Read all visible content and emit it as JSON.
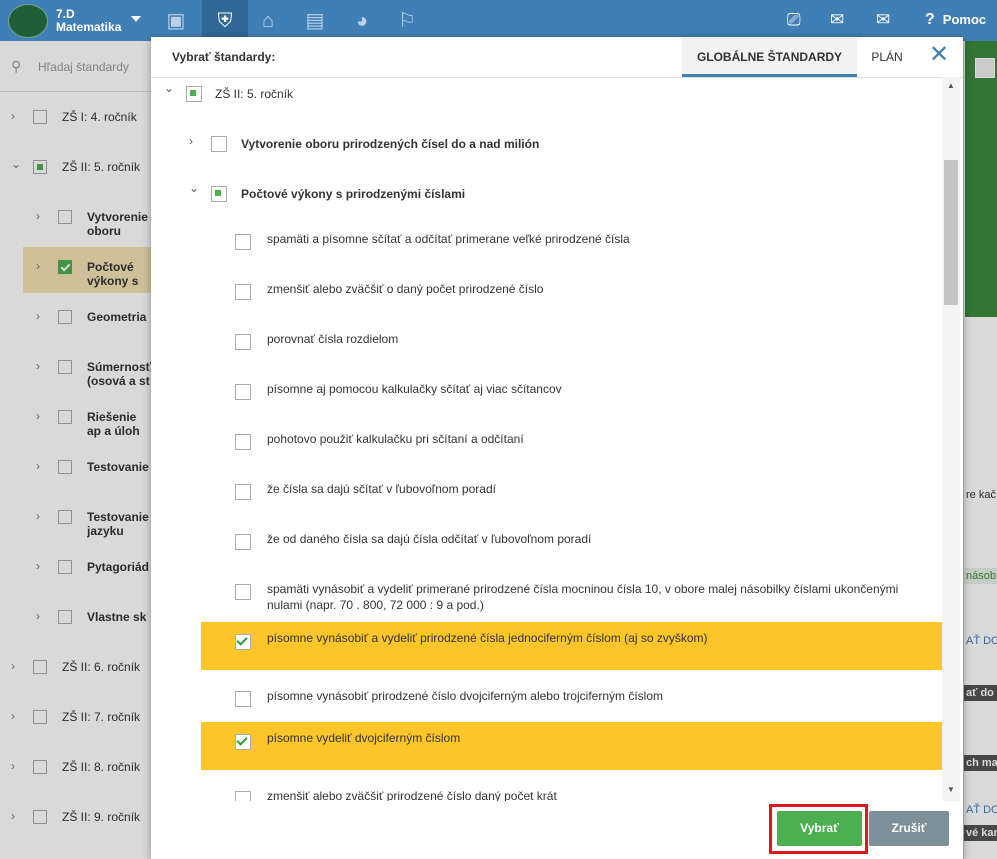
{
  "topbar": {
    "class_name": "7.D",
    "subject": "Matematika",
    "help_label": "Pomoc",
    "nav_icons": [
      "briefcase-icon",
      "shield-check-icon",
      "school-icon",
      "bar-chart-icon",
      "chart-circle-icon",
      "people-walking-icon"
    ],
    "right_icons": [
      "cast-icon",
      "chat-icon",
      "mail-icon"
    ]
  },
  "sidebar": {
    "search_placeholder": "Hľadaj štandardy",
    "items": [
      {
        "label": "ZŠ I: 4. ročník",
        "state": "empty",
        "level": 0,
        "expanded": false
      },
      {
        "label": "ZŠ II: 5. ročník",
        "state": "partial",
        "level": 0,
        "expanded": true
      },
      {
        "label": "Vytvorenie oboru prirodzených",
        "state": "empty",
        "level": 1,
        "expanded": false
      },
      {
        "label": "Počtové výkony s prirodzenými",
        "state": "green",
        "level": 1,
        "expanded": false
      },
      {
        "label": "Geometria",
        "state": "empty",
        "level": 1,
        "expanded": false
      },
      {
        "label": "Súmernosť (osová a st",
        "state": "empty",
        "level": 1,
        "expanded": false
      },
      {
        "label": "Riešenie ap a úloh rozv",
        "state": "empty",
        "level": 1,
        "expanded": false
      },
      {
        "label": "Testovanie",
        "state": "empty",
        "level": 1,
        "expanded": false
      },
      {
        "label": "Testovanie jazyku",
        "state": "empty",
        "level": 1,
        "expanded": false
      },
      {
        "label": "Pytagoriád",
        "state": "empty",
        "level": 1,
        "expanded": false
      },
      {
        "label": "Vlastne sk",
        "state": "empty",
        "level": 1,
        "expanded": false
      },
      {
        "label": "ZŠ II: 6. ročník",
        "state": "empty",
        "level": 0,
        "expanded": false
      },
      {
        "label": "ZŠ II: 7. ročník",
        "state": "empty",
        "level": 0,
        "expanded": false
      },
      {
        "label": "ZŠ II: 8. ročník",
        "state": "empty",
        "level": 0,
        "expanded": false
      },
      {
        "label": "ZŠ II: 9. ročník",
        "state": "empty",
        "level": 0,
        "expanded": false
      }
    ]
  },
  "right_fragments": [
    "re kač",
    "násob",
    "AŤ DO",
    "ať do m",
    "ch mat",
    "AŤ DO",
    "vé kart"
  ],
  "modal": {
    "title": "Vybrať štandardy:",
    "tabs": [
      {
        "label": "GLOBÁLNE ŠTANDARDY",
        "active": true
      },
      {
        "label": "PLÁN",
        "active": false
      }
    ],
    "grade": {
      "label": "ZŠ II: 5. ročník",
      "state": "partial"
    },
    "categories": [
      {
        "label": "Vytvorenie oboru prirodzených čísel do a nad milión",
        "state": "empty",
        "expanded": false
      },
      {
        "label": "Počtové výkony s prirodzenými číslami",
        "state": "partial",
        "expanded": true
      }
    ],
    "standards": [
      {
        "label": "spamäti a písomne sčítať a odčítať primerane veľké prirodzené čísla",
        "checked": false
      },
      {
        "label": "zmenšiť alebo zväčšiť o daný počet prirodzené číslo",
        "checked": false
      },
      {
        "label": "porovnať čísla rozdielom",
        "checked": false
      },
      {
        "label": "písomne aj pomocou kalkulačky sčítať aj viac sčítancov",
        "checked": false
      },
      {
        "label": "pohotovo použiť kalkulačku pri sčítaní a odčítaní",
        "checked": false
      },
      {
        "label": "že čísla sa dajú sčítať v ľubovoľnom poradí",
        "checked": false
      },
      {
        "label": "že od daného čísla sa dajú čísla odčítať v ľubovoľnom poradí",
        "checked": false
      },
      {
        "label": "spamäti vynásobiť a vydeliť primerané prirodzené čísla mocninou čísla 10, v obore malej násobilky číslami ukončenými nulami (napr. 70 . 800, 72 000 : 9 a pod.)",
        "checked": false
      },
      {
        "label": "písomne vynásobiť a vydeliť prirodzené čísla jednociferným číslom (aj so zvyškom)",
        "checked": true
      },
      {
        "label": "písomne vynásobiť prirodzené číslo dvojciferným alebo trojciferným číslom",
        "checked": false
      },
      {
        "label": "písomne vydeliť dvojciferným číslom",
        "checked": true
      },
      {
        "label": "zmenšiť alebo zväčšiť prirodzené číslo daný počet krát",
        "checked": false
      }
    ],
    "buttons": {
      "select": "Vybrať",
      "cancel": "Zrušiť"
    }
  },
  "colors": {
    "topbar": "#3f7fb5",
    "highlight": "#fcc52a",
    "select_button": "#4caf50",
    "cancel_button": "#7d8f98",
    "select_outline": "#e0161f"
  }
}
